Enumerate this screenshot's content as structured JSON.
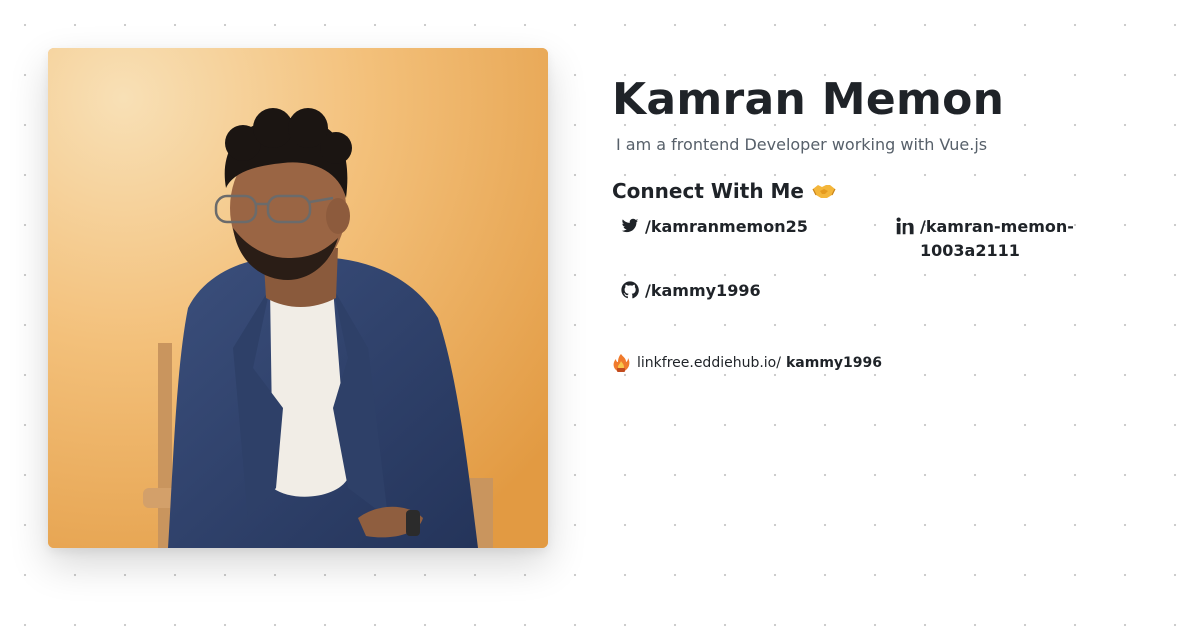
{
  "profile": {
    "name": "Kamran Memon",
    "bio": "I am a frontend Developer working with Vue.js"
  },
  "connect": {
    "heading": "Connect With Me",
    "emoji_icon": "handshake-icon"
  },
  "socials": {
    "twitter": {
      "icon": "twitter-icon",
      "handle": "/kamranmemon25"
    },
    "linkedin": {
      "icon": "linkedin-icon",
      "handle": "/kamran-memon-1003a2111"
    },
    "github": {
      "icon": "github-icon",
      "handle": "/kammy1996"
    }
  },
  "linkfree": {
    "icon": "linkfree-logo-icon",
    "base": "linkfree.eddiehub.io/",
    "username": "kammy1996"
  },
  "colors": {
    "text": "#1f2328",
    "muted": "#57606a",
    "photo_background": "#efb060"
  }
}
